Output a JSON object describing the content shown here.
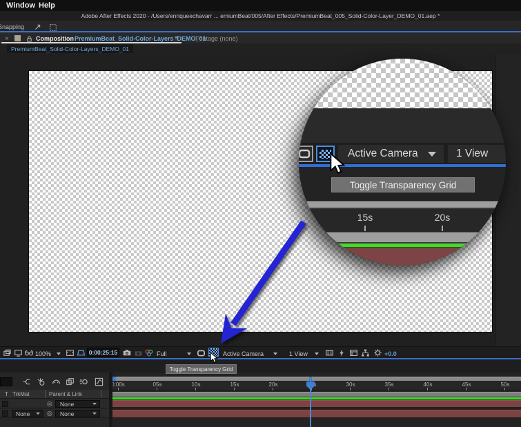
{
  "menu": {
    "window": "Window",
    "help": "Help"
  },
  "title_bar": {
    "text": "Adobe After Effects 2020 - /Users/enriqueechavarr ... emiumBeat/005/After Effects/PremiumBeat_005_Solid-Color-Layer_DEMO_01.aep *"
  },
  "options_bar": {
    "snapping": "Snapping"
  },
  "panel_tabs": {
    "close": "×",
    "composition_label": "Composition",
    "composition_name": "PremiumBeat_Solid-Color-Layers_DEMO_01",
    "panel_menu": "≡",
    "footage_tab": "Footage (none)",
    "viewer_tab": "PremiumBeat_Solid-Color-Layers_DEMO_01"
  },
  "comp_toolbar": {
    "zoom": "100%",
    "timecode": "0:00:25:15",
    "resolution": "Full",
    "camera_view": "Active Camera",
    "view_layout": "1 View",
    "exposure": "+0.0"
  },
  "tooltip": {
    "text": "Toggle Transparency Grid"
  },
  "callout": {
    "camera_view": "Active Camera",
    "view_layout": "1 View",
    "tooltip": "Toggle Transparency Grid",
    "ticks": [
      "15s",
      "20s"
    ]
  },
  "timeline": {
    "header": {
      "t": "T",
      "trkmat": "TrkMat",
      "parent_link": "Parent & Link"
    },
    "rows": [
      {
        "trkmat": "",
        "parent": "None"
      },
      {
        "trkmat": "None",
        "parent": "None"
      }
    ],
    "ruler": [
      "0:00s",
      "05s",
      "10s",
      "15s",
      "20s",
      "25s",
      "30s",
      "35s",
      "40s",
      "45s",
      "50s"
    ]
  },
  "icons": {
    "pickwhip": "◎"
  },
  "colors": {
    "accent_blue": "#3b6fd0",
    "selection_blue": "#4a90e2",
    "link_blue": "#6ca9dd",
    "arrow_blue": "#2424d4",
    "layer_maroon": "#7c4343",
    "marker_green": "#46d42d",
    "timecode_blue": "#a6c9ec"
  }
}
